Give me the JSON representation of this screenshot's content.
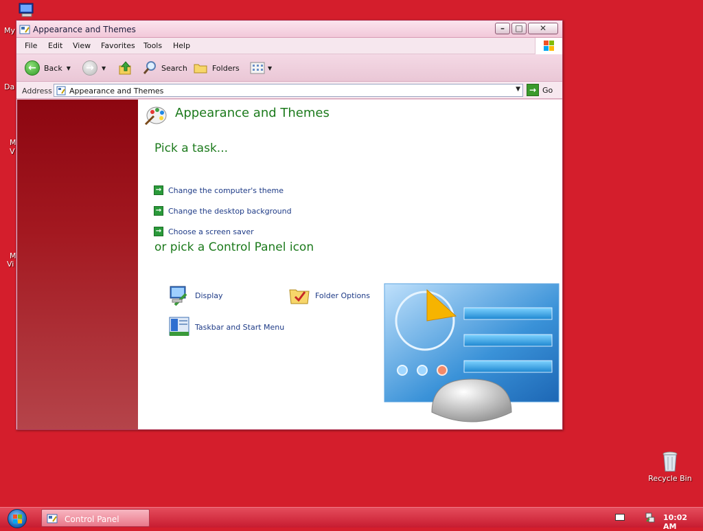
{
  "desktop": {
    "my_computer_label": "My",
    "left_labels": [
      "Da",
      "M",
      "V",
      "M",
      "Vi"
    ],
    "recycle_bin_label": "Recycle Bin"
  },
  "window": {
    "title": "Appearance and Themes",
    "menu": [
      "File",
      "Edit",
      "View",
      "Favorites",
      "Tools",
      "Help"
    ],
    "toolbar": {
      "back_label": "Back",
      "search_label": "Search",
      "folders_label": "Folders"
    },
    "address": {
      "label": "Address",
      "value": "Appearance and Themes",
      "go_label": "Go"
    }
  },
  "content": {
    "title": "Appearance and Themes",
    "pick_task_heading": "Pick a task...",
    "tasks": [
      "Change the computer's theme",
      "Change the desktop background",
      "Choose a screen saver"
    ],
    "pick_icon_heading": "or pick a Control Panel icon",
    "icons": [
      "Display",
      "Folder Options",
      "Taskbar and Start Menu"
    ]
  },
  "taskbar": {
    "task_label": "Control Panel",
    "clock": "10:02 AM"
  },
  "colors": {
    "desktop": "#d41e2c",
    "heading_green": "#1c7a1c",
    "link_blue": "#1d3a86"
  }
}
